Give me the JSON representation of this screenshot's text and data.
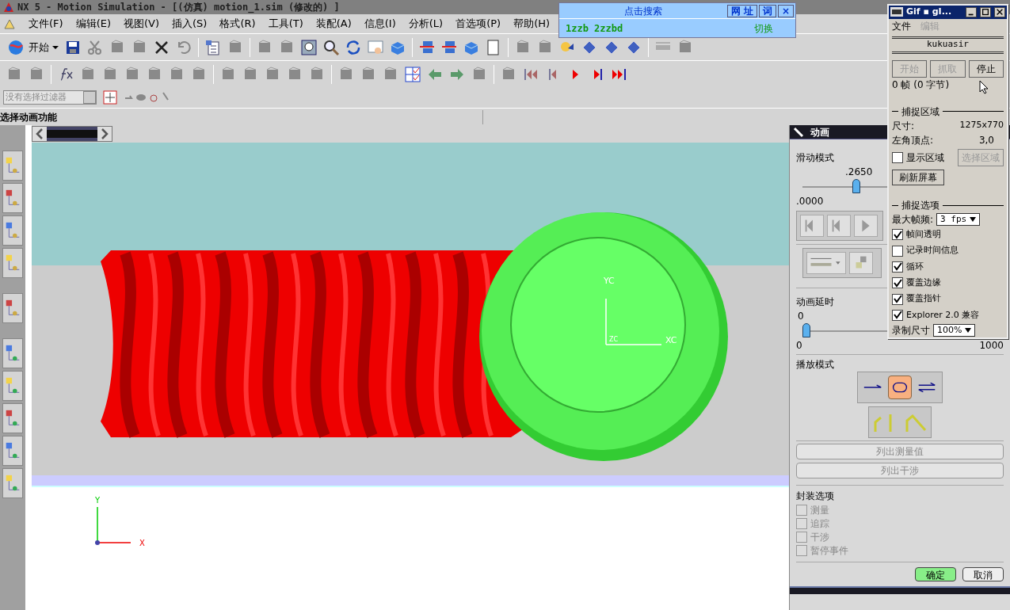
{
  "window": {
    "title": "NX 5 - Motion Simulation - [(仿真) motion_1.sim (修改的) ]"
  },
  "menu": [
    "文件(F)",
    "编辑(E)",
    "视图(V)",
    "插入(S)",
    "格式(R)",
    "工具(T)",
    "装配(A)",
    "信息(I)",
    "分析(L)",
    "首选项(P)",
    "帮助(H)"
  ],
  "toolbar": {
    "start_button": "开始",
    "filter": {
      "placeholder": "没有选择过滤器"
    }
  },
  "cue_line": "选择动画功能",
  "search_bar": {
    "title": "点击搜索",
    "buttons": [
      "网 址",
      "词",
      "×"
    ],
    "text": "1zzb 2zzbd",
    "switch": "切换"
  },
  "viewport": {
    "wcs_labels": [
      "YC",
      "ZC",
      "XC"
    ],
    "triad_labels": [
      "Y",
      "X"
    ]
  },
  "animation_panel": {
    "title": "动画",
    "slide_mode": {
      "label": "滑动模式",
      "reading": ".2650",
      "level": 0.265,
      "min": ".0000"
    },
    "delay": {
      "label": "动画延时",
      "reading": "0",
      "level": 0,
      "min": "0",
      "max": "1000"
    },
    "playback": {
      "label": "播放模式",
      "modes": [
        {
          "selected": false
        },
        {
          "selected": true
        },
        {
          "selected": false
        }
      ]
    },
    "list_buttons": [
      {
        "label": "列出测量值",
        "disabled": true
      },
      {
        "label": "列出干涉",
        "disabled": true
      }
    ],
    "package_options": {
      "label": "封装选项",
      "items": [
        {
          "label": "测量",
          "checked": false,
          "disabled": true
        },
        {
          "label": "追踪",
          "checked": false,
          "disabled": true
        },
        {
          "label": "干涉",
          "checked": false,
          "disabled": true
        },
        {
          "label": "暂停事件",
          "checked": false,
          "disabled": true
        }
      ]
    },
    "ok": "确定",
    "cancel": "取消"
  },
  "gif_window": {
    "title": "Gif ▪ gI...",
    "menu": [
      {
        "label": "文件",
        "disabled": false
      },
      {
        "label": "编辑",
        "disabled": true
      }
    ],
    "name": "kukuasir",
    "buttons": [
      {
        "label": "开始",
        "disabled": true
      },
      {
        "label": "抓取",
        "disabled": true
      },
      {
        "label": "停止",
        "disabled": false
      }
    ],
    "status": "0 帧 (0 字节)",
    "capture_area": {
      "label": "捕捉区域",
      "size_label": "尺寸:",
      "size": "1275x770",
      "corner_label": "左角顶点:",
      "corner": "3,0",
      "show_area": {
        "label": "显示区域",
        "checked": false
      },
      "select_button": {
        "label": "选择区域",
        "disabled": true
      },
      "refresh_button": "刷新屏幕"
    },
    "capture_options": {
      "label": "捕捉选项",
      "rate_label": "最大帧频:",
      "rate": "3 fps",
      "checks": [
        {
          "label": "帧间透明",
          "checked": true
        },
        {
          "label": "记录时间信息",
          "checked": false
        },
        {
          "label": "循环",
          "checked": true
        },
        {
          "label": "覆盖边缘",
          "checked": true
        },
        {
          "label": "覆盖指针",
          "checked": true
        },
        {
          "label": "Explorer 2.0 兼容",
          "checked": true
        }
      ],
      "size_label": "录制尺寸",
      "size": "100%"
    }
  }
}
